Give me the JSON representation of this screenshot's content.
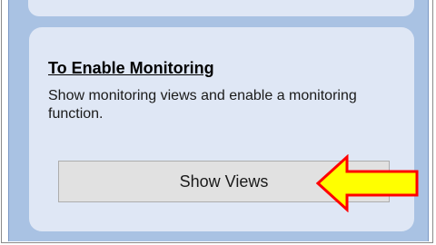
{
  "section": {
    "heading": "To Enable Monitoring",
    "description": "Show monitoring views and enable a monitoring function."
  },
  "button": {
    "label": "Show Views"
  },
  "annotation": {
    "icon": "arrow-left-icon",
    "fill_color": "#ffff00",
    "stroke_color": "#ff0000"
  }
}
